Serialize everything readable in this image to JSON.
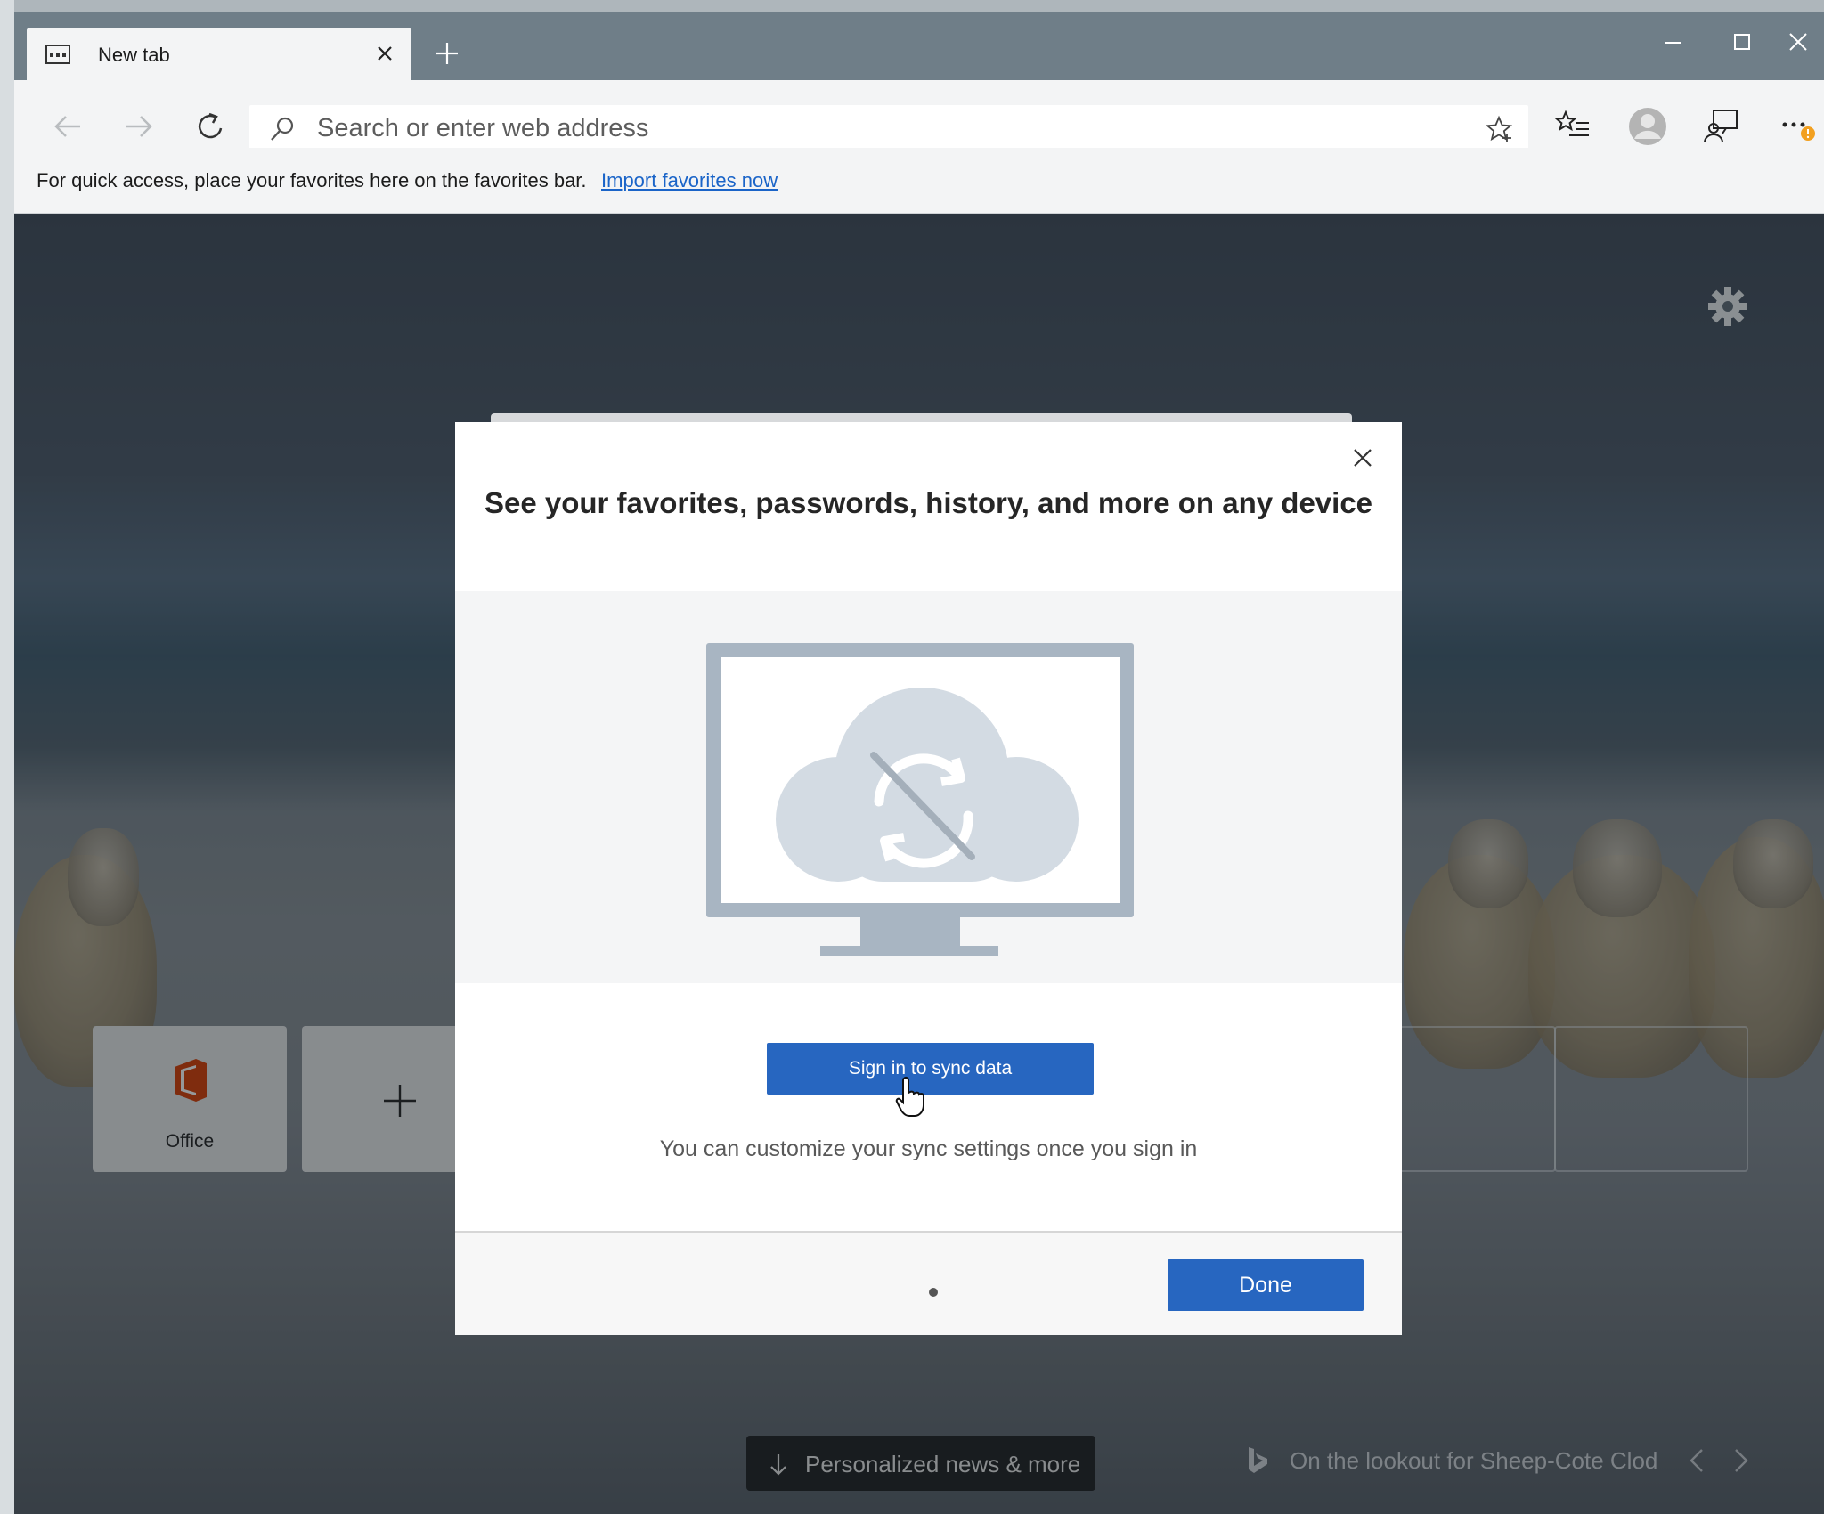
{
  "browser": {
    "tab": {
      "title": "New tab",
      "icon": "new-tab-page-icon"
    },
    "window_controls": [
      "minimize-icon",
      "maximize-icon",
      "close-icon"
    ]
  },
  "toolbar": {
    "address_placeholder": "Search or enter web address",
    "icons": [
      "back-icon",
      "forward-icon",
      "refresh-icon",
      "search-icon",
      "add-favorite-star-icon",
      "favorites-list-icon",
      "profile-avatar-icon",
      "share-feedback-icon",
      "more-menu-icon"
    ]
  },
  "favorites_bar": {
    "message": "For quick access, place your favorites here on the favorites bar.",
    "link": "Import favorites now"
  },
  "page": {
    "tiles": [
      {
        "label": "Office",
        "icon": "office-icon"
      },
      {
        "label": "",
        "icon": "plus-icon"
      }
    ],
    "news_button": "Personalized news & more",
    "image_caption": "On the lookout for Sheep-Cote Clod"
  },
  "dialog": {
    "title": "See your favorites, passwords, history, and more on any device",
    "illustration": "sync-disabled-monitor-illustration",
    "signin_button": "Sign in to sync data",
    "note": "You can customize your sync settings once you sign in",
    "done_button": "Done",
    "page_count": 1
  },
  "colors": {
    "accent": "#2766c0",
    "link": "#1a64c8",
    "titlebar": "#6f7e88",
    "toolbar": "#f3f4f5",
    "office_red": "#d83b01"
  }
}
